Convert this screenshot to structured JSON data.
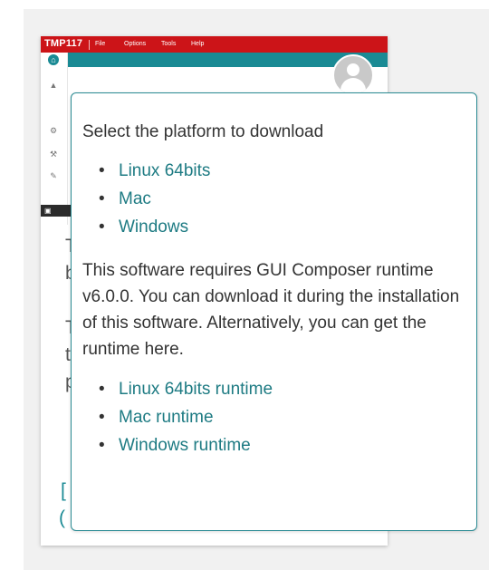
{
  "app": {
    "title": "TMP117",
    "menu": [
      "File",
      "Options",
      "Tools",
      "Help"
    ]
  },
  "popup": {
    "heading": "Select the platform to download",
    "platforms": [
      "Linux 64bits",
      "Mac",
      "Windows"
    ],
    "paragraph": "This software requires GUI Composer runtime v6.0.0. You can download it during the installation of this software. Alternatively, you can get the runtime here.",
    "runtimes": [
      "Linux 64bits runtime",
      "Mac runtime",
      "Windows runtime"
    ]
  },
  "colors": {
    "menubar": "#cc1418",
    "accent": "#1a8a94",
    "link": "#1e7b83"
  },
  "icons": [
    "home-icon",
    "chart-icon",
    "gear-icon",
    "wrench-icon",
    "pencil-icon",
    "console-icon",
    "user-avatar-icon"
  ]
}
